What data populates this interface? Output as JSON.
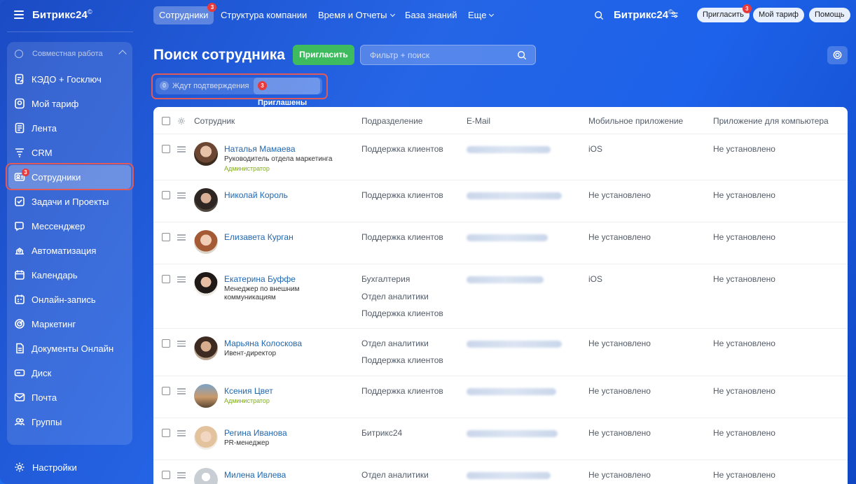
{
  "sidebar": {
    "logo": "Битрикс24",
    "logo_mark": "©",
    "group_label": "Совместная работа",
    "items": [
      {
        "label": "КЭДО + Госключ",
        "icon": "document-sign-icon"
      },
      {
        "label": "Мой тариф",
        "icon": "tariff-icon"
      },
      {
        "label": "Лента",
        "icon": "feed-icon"
      },
      {
        "label": "CRM",
        "icon": "crm-icon"
      },
      {
        "label": "Сотрудники",
        "icon": "employees-icon",
        "badge": "3",
        "active": true
      },
      {
        "label": "Задачи и Проекты",
        "icon": "tasks-icon"
      },
      {
        "label": "Мессенджер",
        "icon": "messenger-icon"
      },
      {
        "label": "Автоматизация",
        "icon": "automation-icon"
      },
      {
        "label": "Календарь",
        "icon": "calendar-icon"
      },
      {
        "label": "Онлайн-запись",
        "icon": "booking-icon"
      },
      {
        "label": "Маркетинг",
        "icon": "marketing-icon"
      },
      {
        "label": "Документы Онлайн",
        "icon": "documents-icon"
      },
      {
        "label": "Диск",
        "icon": "disk-icon"
      },
      {
        "label": "Почта",
        "icon": "mail-icon"
      },
      {
        "label": "Группы",
        "icon": "groups-icon"
      }
    ],
    "settings_label": "Настройки"
  },
  "topbar": {
    "tabs": [
      {
        "label": "Сотрудники",
        "badge": "3",
        "active": true
      },
      {
        "label": "Структура компании"
      },
      {
        "label": "Время и Отчеты",
        "dropdown": true
      },
      {
        "label": "База знаний"
      },
      {
        "label": "Еще",
        "dropdown": true
      }
    ],
    "brand": "Битрикс24",
    "brand_mark": "©",
    "invite_label": "Пригласить",
    "invite_badge": "3",
    "tariff_label": "Мой тариф",
    "help_label": "Помощь"
  },
  "main": {
    "title": "Поиск сотрудника",
    "invite_button": "Пригласить",
    "filter_placeholder": "Фильтр + поиск",
    "status_chips": [
      {
        "count": "0",
        "label": "Ждут подтверждения"
      },
      {
        "count": "3",
        "label": "Приглашены"
      }
    ]
  },
  "table": {
    "columns": [
      "Сотрудник",
      "Подразделение",
      "E-Mail",
      "Мобильное приложение",
      "Приложение для компьютера"
    ],
    "rows": [
      {
        "name": "Наталья Мамаева",
        "position": "Руководитель отдела маркетинга",
        "role": "Администратор",
        "departments": [
          "Поддержка клиентов"
        ],
        "mobile": "iOS",
        "desktop": "Не установлено"
      },
      {
        "name": "Николай Король",
        "position": "",
        "role": "",
        "departments": [
          "Поддержка клиентов"
        ],
        "mobile": "Не установлено",
        "desktop": "Не установлено"
      },
      {
        "name": "Елизавета Курган",
        "position": "",
        "role": "",
        "departments": [
          "Поддержка клиентов"
        ],
        "mobile": "Не установлено",
        "desktop": "Не установлено"
      },
      {
        "name": "Екатерина Буффе",
        "position": "Менеджер по внешним коммуникациям",
        "role": "",
        "departments": [
          "Бухгалтерия",
          "Отдел аналитики",
          "Поддержка клиентов"
        ],
        "mobile": "iOS",
        "desktop": "Не установлено"
      },
      {
        "name": "Марьяна Колоскова",
        "position": "Ивент-директор",
        "role": "",
        "departments": [
          "Отдел аналитики",
          "Поддержка клиентов"
        ],
        "mobile": "Не установлено",
        "desktop": "Не установлено"
      },
      {
        "name": "Ксения Цвет",
        "position": "",
        "role": "Администратор",
        "departments": [
          "Поддержка клиентов"
        ],
        "mobile": "Не установлено",
        "desktop": "Не установлено"
      },
      {
        "name": "Регина Иванова",
        "position": "PR-менеджер",
        "role": "",
        "departments": [
          "Битрикс24"
        ],
        "mobile": "Не установлено",
        "desktop": "Не установлено"
      },
      {
        "name": "Милена Ивлева",
        "position": "",
        "role": "",
        "departments": [
          "Отдел аналитики"
        ],
        "mobile": "Не установлено",
        "desktop": "Не установлено"
      }
    ]
  }
}
